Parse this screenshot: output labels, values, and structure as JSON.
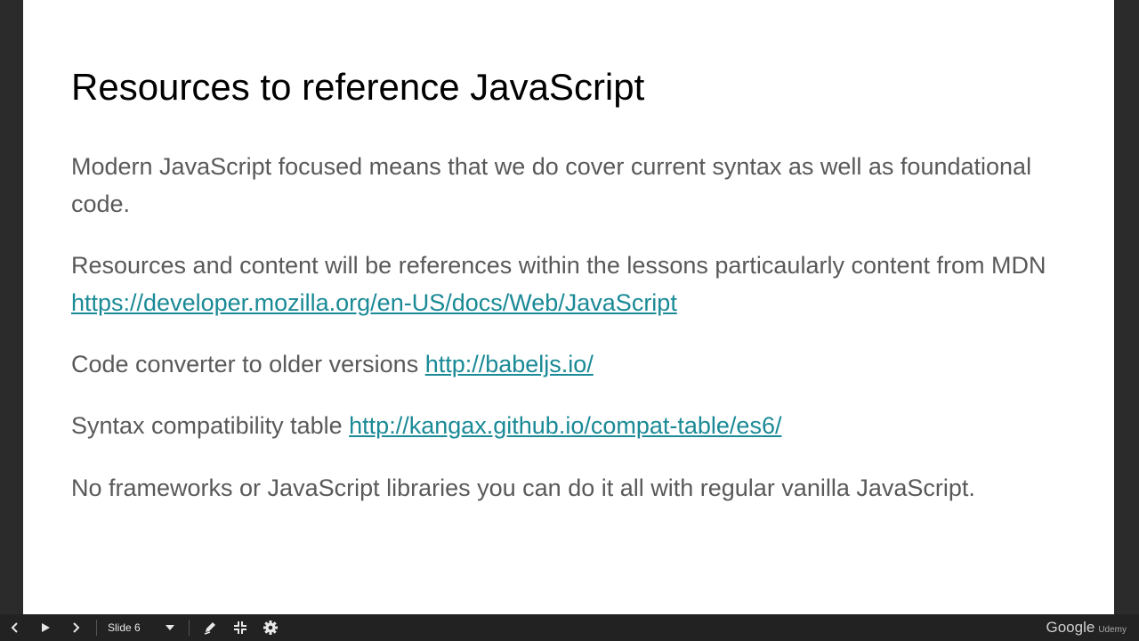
{
  "slide": {
    "title": "Resources to reference JavaScript",
    "paragraphs": [
      {
        "text": "Modern JavaScript focused means that we do cover current syntax as well as foundational code.",
        "link": ""
      },
      {
        "text": "Resources and content will be references within the lessons particaularly  content from MDN ",
        "link": "https://developer.mozilla.org/en-US/docs/Web/JavaScript"
      },
      {
        "text": "Code converter to older versions ",
        "link": "http://babeljs.io/"
      },
      {
        "text": "Syntax compatibility table ",
        "link": "http://kangax.github.io/compat-table/es6/"
      },
      {
        "text": "No frameworks or JavaScript libraries you can do it all with regular vanilla JavaScript.",
        "link": ""
      }
    ]
  },
  "toolbar": {
    "slide_label": "Slide 6",
    "brand": "Google",
    "watermark": "Udemy"
  },
  "colors": {
    "link": "#1a8a96",
    "text": "#595959",
    "toolbar": "#222222"
  }
}
